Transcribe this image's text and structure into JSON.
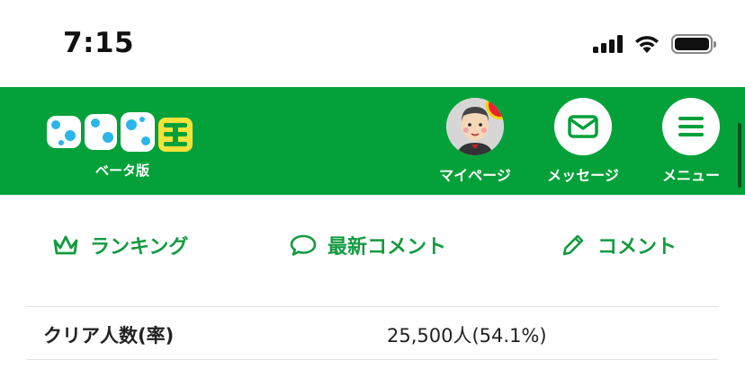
{
  "status_bar": {
    "time": "7:15"
  },
  "header": {
    "logo_text": "マイネ王",
    "logo_subtitle": "ベータ版",
    "background_color": "#04a13a",
    "nav": [
      {
        "label": "マイページ",
        "icon": "avatar-icon",
        "badge": "!"
      },
      {
        "label": "メッセージ",
        "icon": "envelope-icon"
      },
      {
        "label": "メニュー",
        "icon": "hamburger-menu-icon"
      }
    ]
  },
  "tabs": [
    {
      "label": "ランキング",
      "icon": "crown-icon"
    },
    {
      "label": "最新コメント",
      "icon": "speech-bubble-icon"
    },
    {
      "label": "コメント",
      "icon": "pencil-icon"
    }
  ],
  "stats": [
    {
      "label": "クリア人数(率)",
      "value": "25,500人(54.1%)"
    }
  ],
  "colors": {
    "accent_green": "#139a40",
    "alert_red": "#e8242e",
    "badge_ring": "#f6d200"
  }
}
